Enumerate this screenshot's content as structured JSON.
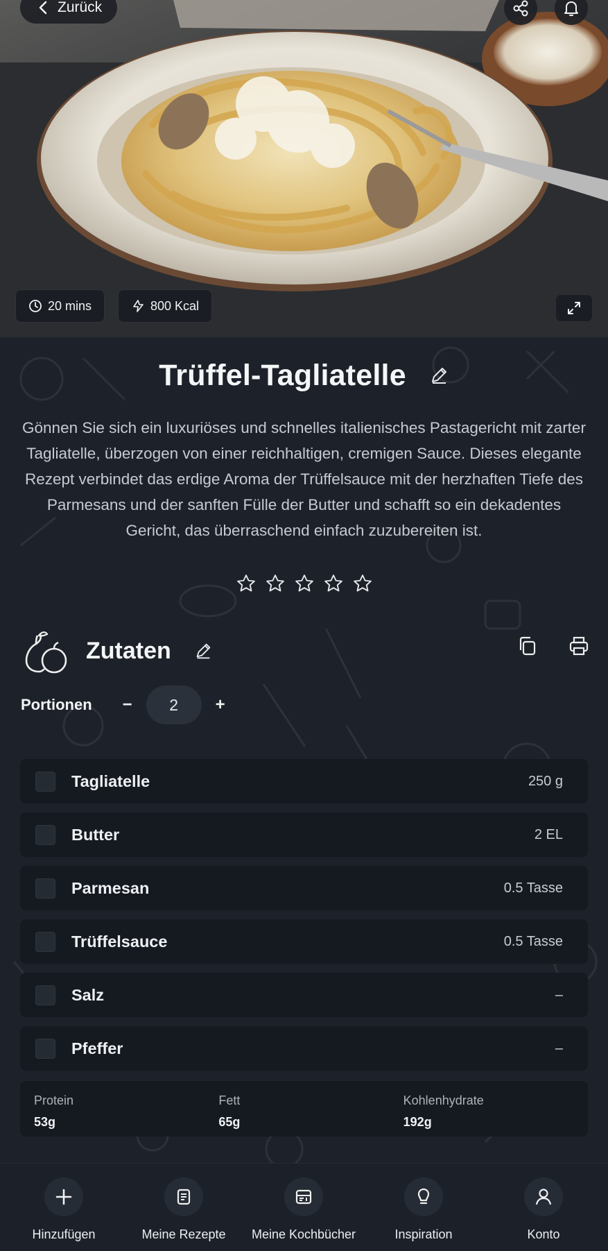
{
  "header": {
    "back_label": "Zurück",
    "share_icon": "share-icon",
    "bell_icon": "bell-icon"
  },
  "hero": {
    "time": "20 mins",
    "calories": "800 Kcal"
  },
  "recipe": {
    "title": "Trüffel-Tagliatelle",
    "description": "Gönnen Sie sich ein luxuriöses und schnelles italienisches Pastagericht mit zarter Tagliatelle, überzogen von einer reichhaltigen, cremigen Sauce. Dieses elegante Rezept verbindet das erdige Aroma der Trüffelsauce mit der herzhaften Tiefe des Parmesans und der sanften Fülle der Butter und schafft so ein dekadentes Gericht, das überraschend einfach zuzubereiten ist.",
    "rating": 0,
    "rating_max": 5
  },
  "ingredients_section": {
    "title": "Zutaten",
    "portions_label": "Portionen",
    "minus": "−",
    "plus": "+",
    "portions": "2"
  },
  "ingredients": [
    {
      "name": "Tagliatelle",
      "amount": "250 g"
    },
    {
      "name": "Butter",
      "amount": "2 EL"
    },
    {
      "name": "Parmesan",
      "amount": "0.5 Tasse"
    },
    {
      "name": "Trüffelsauce",
      "amount": "0.5 Tasse"
    },
    {
      "name": "Salz",
      "amount": "–"
    },
    {
      "name": "Pfeffer",
      "amount": "–"
    }
  ],
  "nutrition": [
    {
      "label": "Protein",
      "value": "53g"
    },
    {
      "label": "Fett",
      "value": "65g"
    },
    {
      "label": "Kohlenhydrate",
      "value": "192g"
    }
  ],
  "bottom_nav": [
    {
      "label": "Hinzufügen",
      "icon": "plus-icon"
    },
    {
      "label": "Meine Rezepte",
      "icon": "recipe-icon"
    },
    {
      "label": "Meine Kochbücher",
      "icon": "cookbook-icon"
    },
    {
      "label": "Inspiration",
      "icon": "lightbulb-icon"
    },
    {
      "label": "Konto",
      "icon": "user-icon"
    }
  ]
}
